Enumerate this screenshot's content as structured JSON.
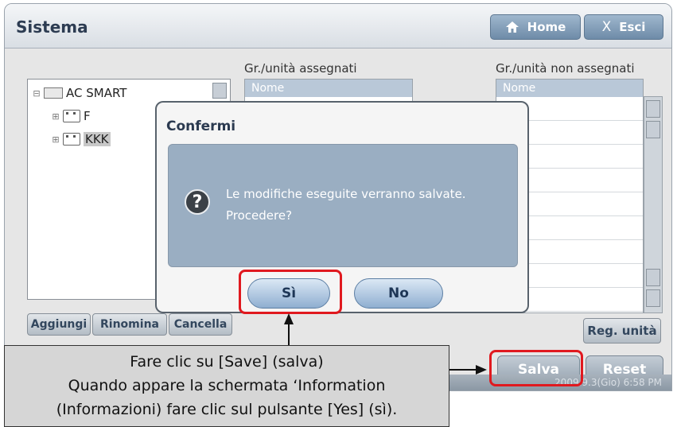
{
  "window": {
    "title": "Sistema",
    "home_label": "Home",
    "exit_label": "Esci",
    "exit_icon": "X"
  },
  "tree": {
    "root": "AC SMART",
    "children": [
      "F",
      "KKK"
    ],
    "buttons": [
      "Aggiungi",
      "Rinomina",
      "Cancella"
    ]
  },
  "assigned": {
    "heading": "Gr./unità assegnati",
    "column": "Nome"
  },
  "unassigned": {
    "heading": "Gr./unità non assegnati",
    "column": "Nome"
  },
  "actions": {
    "reg_unit": "Reg. unità",
    "save": "Salva",
    "reset": "Reset"
  },
  "status": {
    "datetime": "2009.9.3(Gio)  6:58 PM"
  },
  "dialog": {
    "title": "Confermi",
    "message": "Le modifiche eseguite verranno salvate.\nProcedere?",
    "yes": "Sì",
    "no": "No",
    "icon_glyph": "?"
  },
  "callout": {
    "line1": "Fare clic su [Save] (salva)",
    "line2": "Quando appare la schermata ‘Information",
    "line3": "(Informazioni) fare clic sul pulsante [Yes] (sì)."
  },
  "colors": {
    "highlight": "#e0191f"
  }
}
